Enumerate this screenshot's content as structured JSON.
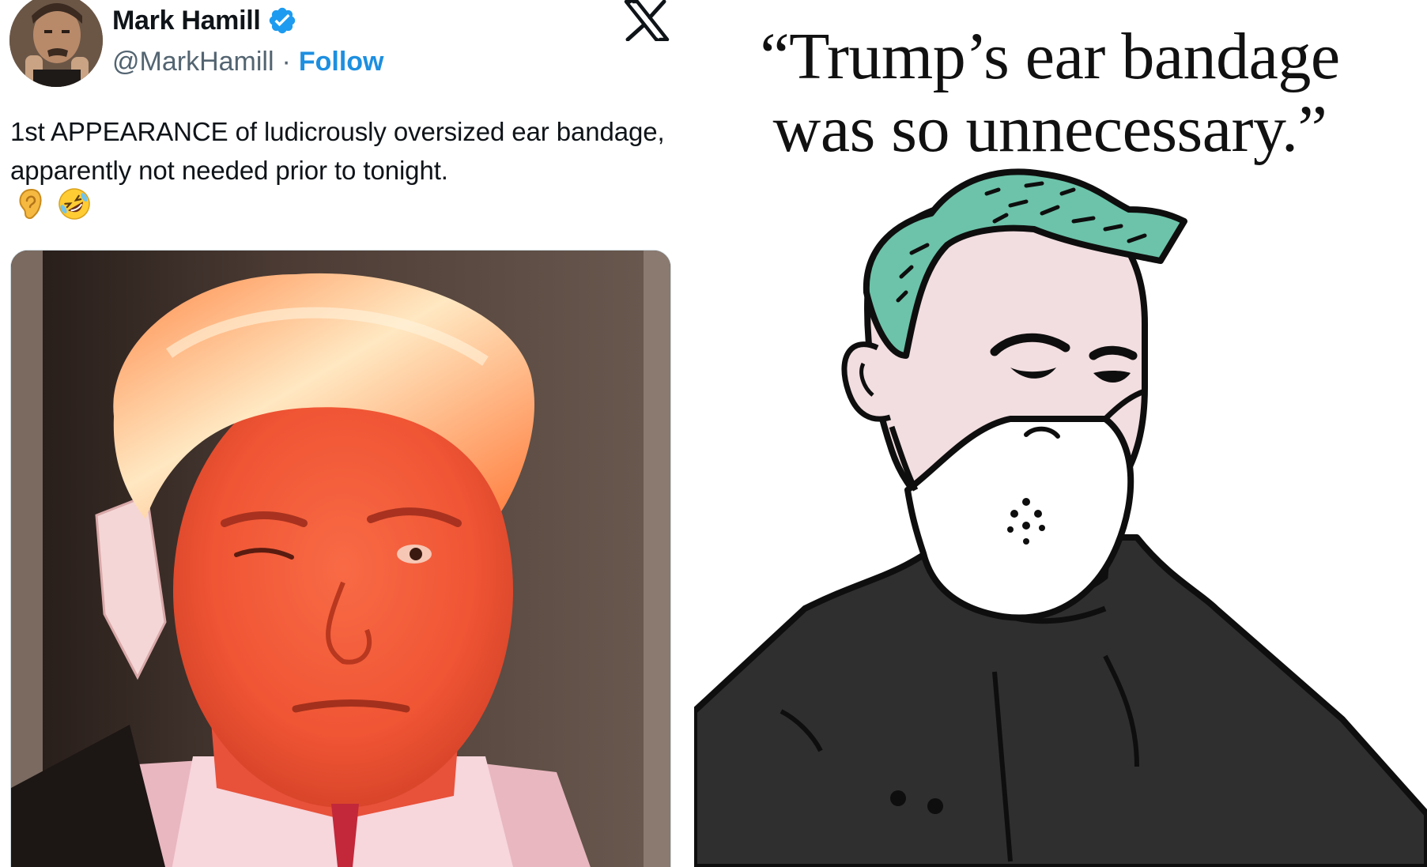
{
  "tweet": {
    "author_name": "Mark Hamill",
    "handle": "@MarkHamill",
    "separator": "·",
    "follow_label": "Follow",
    "verified_icon": "verified-badge-icon",
    "platform_icon": "x-logo-icon",
    "text": "1st APPEARANCE of ludicrously oversized ear bandage, apparently not needed prior to tonight.",
    "emojis": [
      "ear-emoji",
      "rolling-on-floor-laughing-emoji"
    ],
    "media_description_icon": "photo-icon"
  },
  "cartoon": {
    "quote_line_1": "“Trump’s ear bandage",
    "quote_line_2": "was so unnecessary.”"
  },
  "colors": {
    "link_blue": "#1d8fe0",
    "verified_blue": "#1d9bf0",
    "cartoon_hair": "#6cc3a9",
    "cartoon_skin": "#f2dde0",
    "hoodie": "#2f2f2f"
  }
}
